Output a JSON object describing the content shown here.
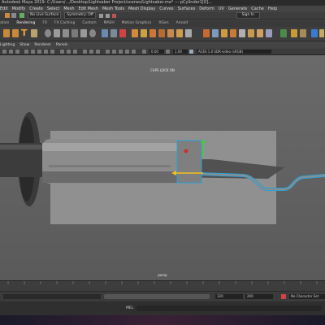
{
  "title_bar": {
    "text": "Autodesk Maya 2019: C:/Users/…/Desktop/Lightsaber Project/scenes/Lightsaber.ma* --- pCylinder1[0]..."
  },
  "menu_bar": {
    "items": [
      "Edit",
      "Modify",
      "Create",
      "Select",
      "Mesh",
      "Edit Mesh",
      "Mesh Tools",
      "Mesh Display",
      "Curves",
      "Surfaces",
      "Deform",
      "UV",
      "Generate",
      "Cache",
      "Help"
    ]
  },
  "status_line": {
    "live_surface": "No Live Surface",
    "symmetry": "Symmetry: Off",
    "sign_in": "Sign In"
  },
  "shelf_tabs": [
    "ation",
    "Rendering",
    "FX",
    "FX Caching",
    "Custom",
    "MASH",
    "Motion Graphics",
    "XGen",
    "Arnold"
  ],
  "panel_menu": {
    "items": [
      "Lighting",
      "Show",
      "Renderer",
      "Panels"
    ]
  },
  "panel_toolbar": {
    "gamma": "1.00",
    "color_space": "ACES 1.0 SDR-video (sRGB)"
  },
  "viewport": {
    "caps_lock": "CAPS LOCK ON",
    "camera": "persp"
  },
  "range": {
    "start": "120",
    "end": "200",
    "character_set": "No Character Set"
  },
  "command_line": {
    "label": "MEL"
  },
  "colors": {
    "accent": "#5ab4d6",
    "selection": "#2a9fd6",
    "viewport": "#626262"
  }
}
